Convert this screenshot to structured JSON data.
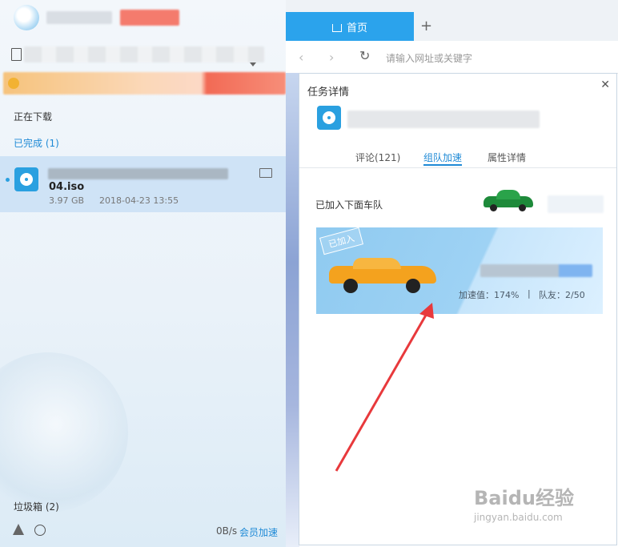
{
  "sidebar": {
    "downloading": "正在下载",
    "completed": "已完成 (1)",
    "file": {
      "name": "04.iso",
      "size": "3.97 GB",
      "date": "2018-04-23 13:55"
    },
    "trash": "垃圾箱 (2)",
    "speed": "0B/s",
    "vip": "会员加速"
  },
  "browser": {
    "tab_label": "首页",
    "new_tab": "+",
    "address_placeholder": "请输入网址或关键字"
  },
  "panel": {
    "title": "任务详情",
    "close": "✕",
    "tabs": [
      {
        "label": "评论(121)"
      },
      {
        "label": "组队加速"
      },
      {
        "label": "属性详情"
      }
    ],
    "team_label": "已加入下面车队",
    "joined_badge": "已加入",
    "speed_value": "加速值：174%",
    "separator": "|",
    "teammates": "队友：2/50"
  },
  "watermark": {
    "brand": "Baidu经验",
    "url": "jingyan.baidu.com"
  },
  "colors": {
    "accent": "#2ba3ec",
    "selected_row": "#cfe3f6",
    "arrow": "#e8393c"
  }
}
